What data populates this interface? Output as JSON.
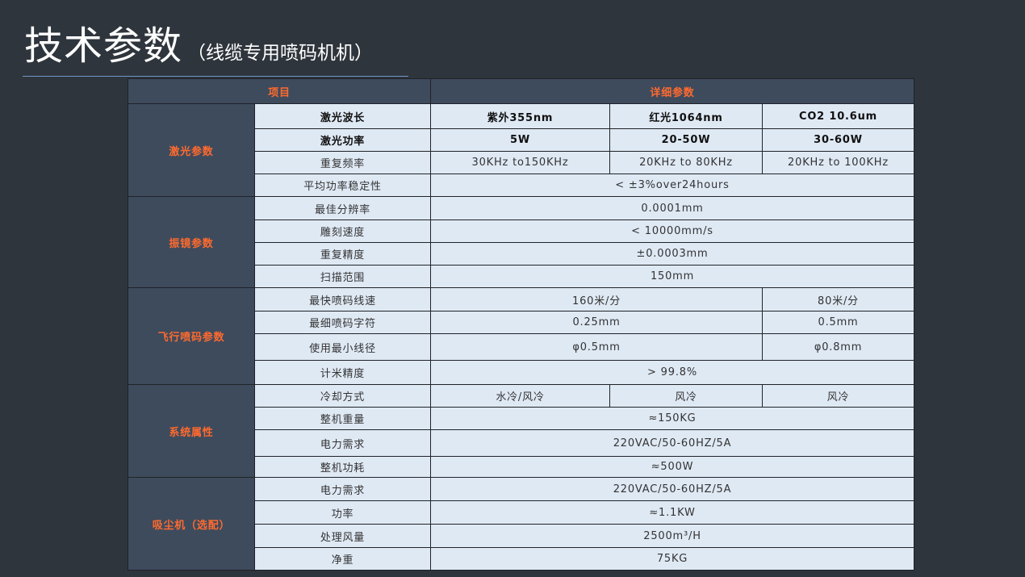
{
  "title": {
    "main": "技术参数",
    "sub": "（线缆专用喷码机机）"
  },
  "table": {
    "header": {
      "item": "项目",
      "detail": "详细参数"
    },
    "groups": [
      {
        "name": "激光参数",
        "rows": [
          {
            "label": "激光波长",
            "values": [
              "紫外355nm",
              "红光1064nm",
              "CO2 10.6um"
            ]
          },
          {
            "label": "激光功率",
            "values": [
              "5W",
              "20-50W",
              "30-60W"
            ]
          },
          {
            "label": "重复频率",
            "values": [
              "30KHz to150KHz",
              "20KHz to 80KHz",
              "20KHz to 100KHz"
            ]
          },
          {
            "label": "平均功率稳定性",
            "values": [
              "< ±3%over24hours"
            ]
          }
        ]
      },
      {
        "name": "振镜参数",
        "rows": [
          {
            "label": "最佳分辨率",
            "values": [
              "0.0001mm"
            ]
          },
          {
            "label": "雕刻速度",
            "values": [
              "< 10000mm/s"
            ]
          },
          {
            "label": "重复精度",
            "values": [
              "±0.0003mm"
            ]
          },
          {
            "label": "扫描范围",
            "values": [
              "150mm"
            ]
          }
        ]
      },
      {
        "name": "飞行喷码参数",
        "rows": [
          {
            "label": "最快喷码线速",
            "values": [
              "160米/分",
              "80米/分"
            ]
          },
          {
            "label": "最细喷码字符",
            "values": [
              "0.25mm",
              "0.5mm"
            ]
          },
          {
            "label": "使用最小线径",
            "values": [
              "φ0.5mm",
              "φ0.8mm"
            ]
          },
          {
            "label": "计米精度",
            "values": [
              "> 99.8%"
            ]
          }
        ]
      },
      {
        "name": "系统属性",
        "rows": [
          {
            "label": "冷却方式",
            "values": [
              "水冷/风冷",
              "风冷",
              "风冷"
            ]
          },
          {
            "label": "整机重量",
            "values": [
              "≈150KG"
            ]
          },
          {
            "label": "电力需求",
            "values": [
              "220VAC/50-60HZ/5A"
            ]
          },
          {
            "label": "整机功耗",
            "values": [
              "≈500W"
            ]
          }
        ]
      },
      {
        "name": "吸尘机（选配）",
        "rows": [
          {
            "label": "电力需求",
            "values": [
              "220VAC/50-60HZ/5A"
            ]
          },
          {
            "label": "功率",
            "values": [
              "≈1.1KW"
            ]
          },
          {
            "label": "处理风量",
            "values": [
              "2500m³/H"
            ]
          },
          {
            "label": "净重",
            "values": [
              "75KG"
            ]
          }
        ]
      }
    ]
  },
  "colors": {
    "background": "#2f353c",
    "header_fill": "#3e4b5d",
    "accent_text": "#ff6a2e",
    "cell_fill": "#dfe9f4"
  }
}
